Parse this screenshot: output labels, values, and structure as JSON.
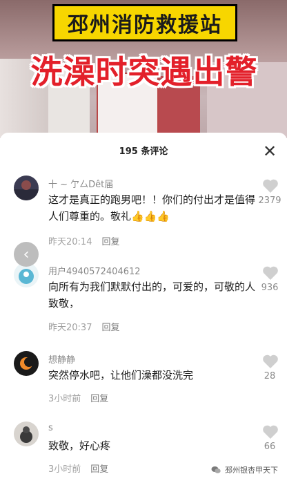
{
  "video": {
    "banner_title": "邳州消防救援站",
    "banner_subtitle": "洗澡时突遇出警"
  },
  "comments_panel": {
    "title": "195 条评论",
    "close_icon": "close-icon",
    "comments": [
      {
        "user": "十 ~ 亇厶Dêt届",
        "text": "这才是真正的跑男吧！！你们的付出才是值得人们尊重的。敬礼👍👍👍",
        "time": "昨天20:14",
        "reply_label": "回复",
        "likes": "2379"
      },
      {
        "user": "用户4940572404612",
        "text": "向所有为我们默默付出的，可爱的，可敬的人致敬，",
        "time": "昨天20:37",
        "reply_label": "回复",
        "likes": "936"
      },
      {
        "user": "想静静",
        "text": "突然停水吧，让他们澡都没洗完",
        "time": "3小时前",
        "reply_label": "回复",
        "likes": "28"
      },
      {
        "user": "s",
        "text": "致敬，好心疼",
        "time": "3小时前",
        "reply_label": "回复",
        "likes": "66"
      }
    ]
  },
  "overlay": {
    "back_icon": "chevron-left-icon"
  },
  "watermark": {
    "text": "邳州银杏甲天下",
    "icon": "wechat-icon"
  },
  "colors": {
    "banner_yellow": "#f7d600",
    "subtitle_red": "#e3202a",
    "meta_gray": "#a0a0a0"
  }
}
